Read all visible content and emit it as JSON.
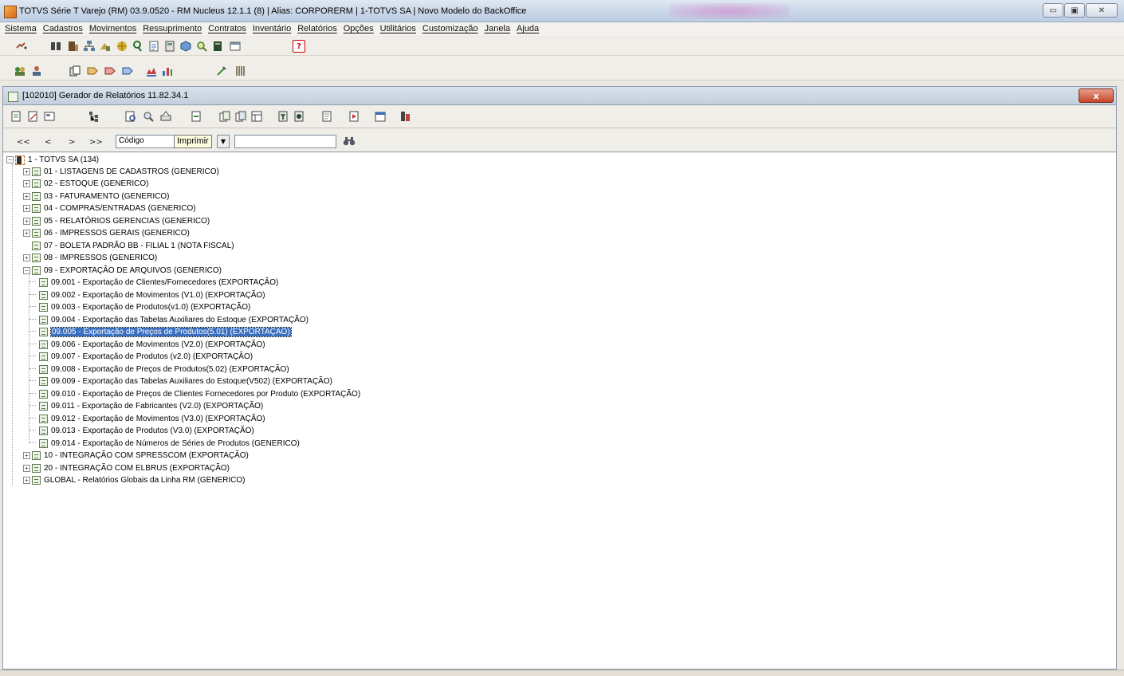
{
  "window": {
    "title": "TOTVS Série T Varejo (RM) 03.9.0520 - RM Nucleus 12.1.1 (8) | Alias: CORPORERM | 1-TOTVS SA | Novo Modelo do BackOffice",
    "minimize_label": "▭",
    "maximize_label": "▣",
    "close_label": "✕"
  },
  "menu": {
    "items": [
      "Sistema",
      "Cadastros",
      "Movimentos",
      "Ressuprimento",
      "Contratos",
      "Inventário",
      "Relatórios",
      "Opções",
      "Utilitários",
      "Customização",
      "Janela",
      "Ajuda"
    ]
  },
  "toolbar": {
    "help_label": "?"
  },
  "frame": {
    "title": "[102010]  Gerador de Relatórios 11.82.34.1",
    "close_label": "x"
  },
  "nav": {
    "first": "<<",
    "prev": "<",
    "next": ">",
    "last": ">>",
    "search_field_value": "Código",
    "tooltip": "Imprimir",
    "search_text_value": "",
    "find_icon": "find-icon"
  },
  "colors": {
    "selection": "#3a6ebf",
    "frame_close": "#c6452c"
  },
  "tree": {
    "root": "1 - TOTVS SA (134)",
    "groups": [
      {
        "label": "01 - LISTAGENS DE CADASTROS (GENERICO)",
        "expand": "+"
      },
      {
        "label": "02 - ESTOQUE (GENERICO)",
        "expand": "+"
      },
      {
        "label": "03 - FATURAMENTO (GENERICO)",
        "expand": "+"
      },
      {
        "label": "04 - COMPRAS/ENTRADAS (GENERICO)",
        "expand": "+"
      },
      {
        "label": "05 - RELATÓRIOS GERENCIAS (GENERICO)",
        "expand": "+"
      },
      {
        "label": "06 - IMPRESSOS GERAIS (GENERICO)",
        "expand": "+"
      },
      {
        "label": "07 - BOLETA PADRÃO BB - FILIAL 1 (NOTA FISCAL)",
        "expand": ""
      },
      {
        "label": "08 - IMPRESSOS (GENERICO)",
        "expand": "+"
      },
      {
        "label": "09 - EXPORTAÇÃO DE ARQUIVOS (GENERICO)",
        "expand": "−"
      }
    ],
    "children_09": [
      "09.001 - Exportação de Clientes/Fornecedores (EXPORTAÇÃO)",
      "09.002 - Exportação de Movimentos (V1.0) (EXPORTAÇÃO)",
      "09.003 - Exportação de Produtos(v1.0) (EXPORTAÇÃO)",
      "09.004 - Exportação das Tabelas Auxiliares do Estoque (EXPORTAÇÃO)",
      "09.005 - Exportação de Preços de Produtos(5.01) (EXPORTAÇÃO)",
      "09.006 - Exportação de Movimentos (V2.0) (EXPORTAÇÃO)",
      "09.007 - Exportação de Produtos (v2.0) (EXPORTAÇÃO)",
      "09.008 - Exportação de Preços de Produtos(5.02) (EXPORTAÇÃO)",
      "09.009 - Exportação das Tabelas Auxiliares do Estoque(V502) (EXPORTAÇÃO)",
      "09.010 - Exportação de Preços de Clientes Fornecedores por Produto (EXPORTAÇÃO)",
      "09.011 -  Exportação de Fabricantes (V2.0) (EXPORTAÇÃO)",
      "09.012 - Exportação de Movimentos (V3.0) (EXPORTAÇÃO)",
      "09.013 - Exportação de Produtos (V3.0) (EXPORTAÇÃO)",
      "09.014 - Exportação de Números de Séries de Produtos (GENERICO)"
    ],
    "selected_child": 4,
    "groups_after": [
      {
        "label": "10 - INTEGRAÇÃO COM SPRESSCOM (EXPORTAÇÃO)",
        "expand": "+"
      },
      {
        "label": "20 - INTEGRAÇÃO COM ELBRUS (EXPORTAÇÃO)",
        "expand": "+"
      },
      {
        "label": "GLOBAL - Relatórios Globais da Linha RM (GENERICO)",
        "expand": "+"
      }
    ]
  }
}
